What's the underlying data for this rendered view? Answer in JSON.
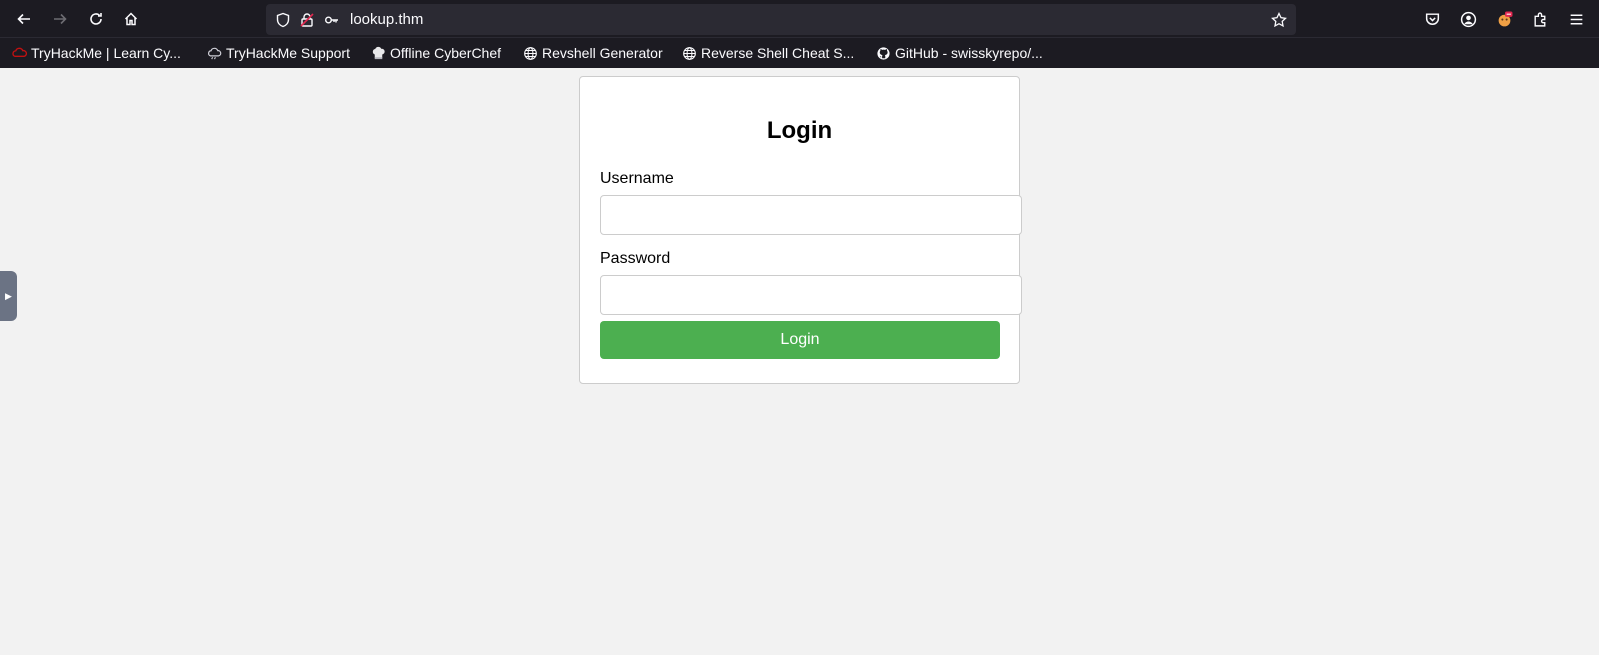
{
  "browser": {
    "url": "lookup.thm",
    "bookmarks": [
      {
        "label": "TryHackMe | Learn Cy...",
        "icon": "tryhackme-icon"
      },
      {
        "label": "TryHackMe Support",
        "icon": "cloud-icon"
      },
      {
        "label": "Offline CyberChef",
        "icon": "chef-icon"
      },
      {
        "label": "Revshell Generator",
        "icon": "globe-icon"
      },
      {
        "label": "Reverse Shell Cheat S...",
        "icon": "globe-icon"
      },
      {
        "label": "GitHub - swisskyrepo/...",
        "icon": "github-icon"
      }
    ]
  },
  "login": {
    "title": "Login",
    "username_label": "Username",
    "username_value": "",
    "password_label": "Password",
    "password_value": "",
    "submit_label": "Login"
  },
  "colors": {
    "accent": "#4caf50",
    "toolbar": "#1c1b22",
    "page_bg": "#f2f2f2"
  }
}
